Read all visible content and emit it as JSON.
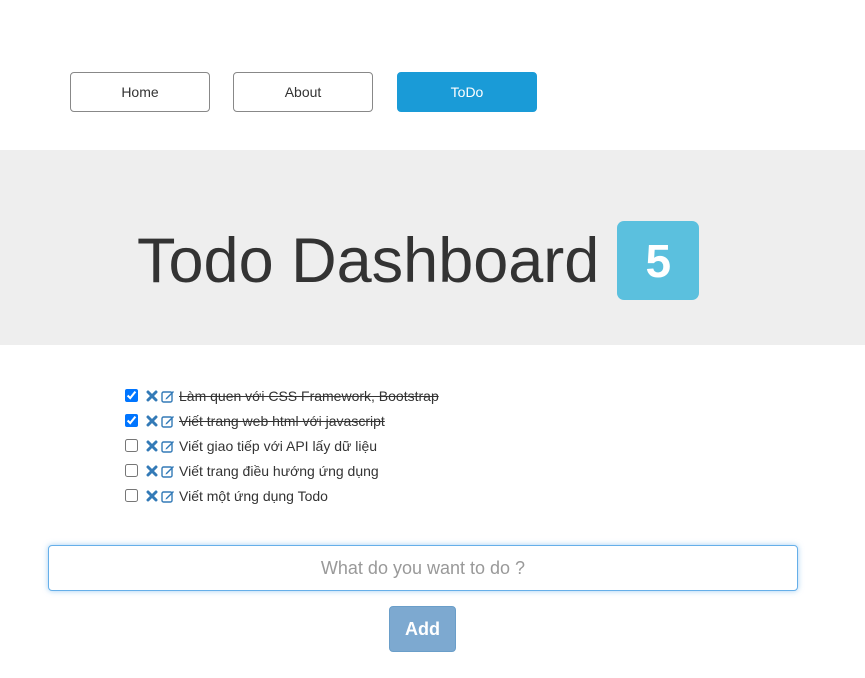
{
  "nav": {
    "items": [
      {
        "label": "Home",
        "active": false
      },
      {
        "label": "About",
        "active": false
      },
      {
        "label": "ToDo",
        "active": true
      }
    ],
    "active_color": "#1a9bd7"
  },
  "dashboard": {
    "title": "Todo Dashboard",
    "count": "5",
    "badge_color": "#5bc0de"
  },
  "todos": [
    {
      "text": "Làm quen với CSS Framework, Bootstrap",
      "done": true
    },
    {
      "text": "Viết trang web html với javascript",
      "done": true
    },
    {
      "text": "Viết giao tiếp với API lấy dữ liệu",
      "done": false
    },
    {
      "text": "Viết trang điều hướng ứng dụng",
      "done": false
    },
    {
      "text": "Viết một ứng dụng Todo",
      "done": false
    }
  ],
  "icons": {
    "delete": "delete-icon",
    "edit": "edit-icon",
    "delete_color": "#337ab7",
    "edit_color": "#337ab7"
  },
  "form": {
    "input_value": "",
    "input_placeholder": "What do you want to do ?",
    "add_label": "Add"
  }
}
